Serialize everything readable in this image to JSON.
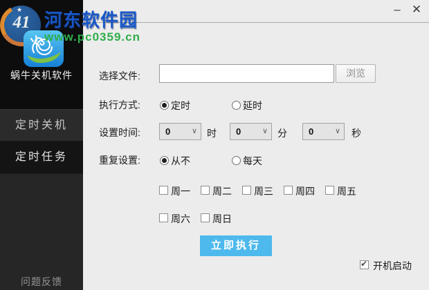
{
  "window": {
    "controls": {
      "minimize": "–",
      "close": "✕"
    }
  },
  "watermark": {
    "site_name": "河东软件园",
    "site_url": "www.pc0359.cn",
    "logo_text": "41",
    "star": "★",
    "name_color": "#1857c8",
    "url_color": "#2fae4a"
  },
  "sidebar": {
    "app_name": "蜗牛关机软件",
    "items": [
      {
        "label": "定时关机",
        "active": false
      },
      {
        "label": "定时任务",
        "active": true
      }
    ],
    "footer_label": "问题反馈"
  },
  "form": {
    "file": {
      "label": "选择文件:",
      "value": "",
      "browse": "浏览"
    },
    "mode": {
      "label": "执行方式:",
      "options": [
        {
          "label": "定时",
          "selected": true
        },
        {
          "label": "延时",
          "selected": false
        }
      ]
    },
    "time": {
      "label": "设置时间:",
      "fields": [
        {
          "value": "0",
          "unit": "时"
        },
        {
          "value": "0",
          "unit": "分"
        },
        {
          "value": "0",
          "unit": "秒"
        }
      ]
    },
    "repeat": {
      "label": "重复设置:",
      "options": [
        {
          "label": "从不",
          "selected": true
        },
        {
          "label": "每天",
          "selected": false
        }
      ]
    },
    "weekdays_row1": [
      {
        "label": "周一",
        "checked": false
      },
      {
        "label": "周二",
        "checked": false
      },
      {
        "label": "周三",
        "checked": false
      },
      {
        "label": "周四",
        "checked": false
      },
      {
        "label": "周五",
        "checked": false
      }
    ],
    "weekdays_row2": [
      {
        "label": "周六",
        "checked": false
      },
      {
        "label": "周日",
        "checked": false
      }
    ],
    "execute_label": "立即执行",
    "autostart": {
      "label": "开机启动",
      "checked": true
    }
  },
  "icons": {
    "chevron_down": "∨",
    "check": "✔"
  },
  "colors": {
    "accent_blue": "#4db9ec",
    "main_bg": "#ececec",
    "sidebar_bg": "#262626",
    "sidebar_active_bg": "#141414",
    "logo_area_bg": "#0d0d0d"
  }
}
